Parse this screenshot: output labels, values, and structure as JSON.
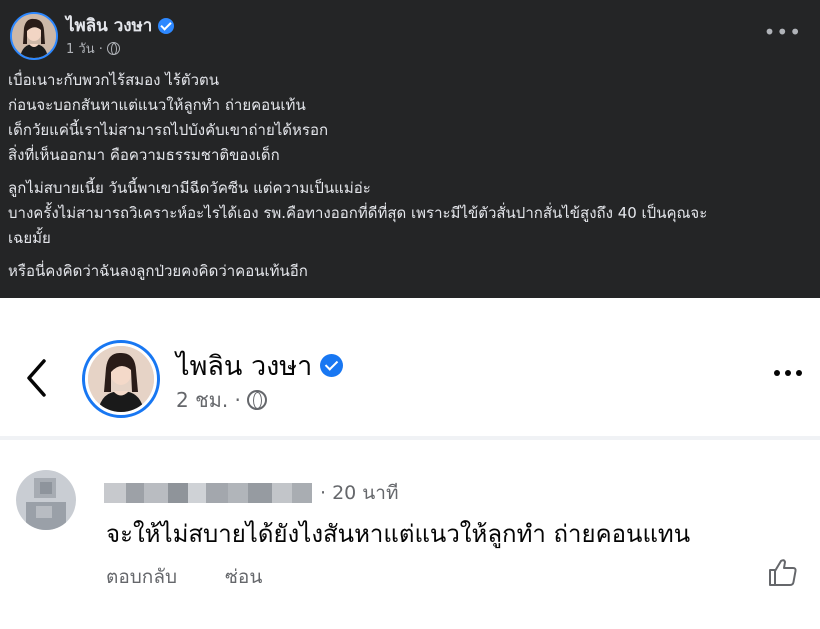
{
  "dark_post": {
    "author": "ไพลิน วงษา",
    "time": "1 วัน ·",
    "more_label": "•••",
    "lines_p1": [
      "เบื่อเนาะกับพวกไร้สมอง ไร้ตัวตน",
      "ก่อนจะบอกสันหาแต่แนวให้ลูกทำ ถ่ายคอนเท้น",
      "เด็กวัยแค่นี้เราไม่สามารถไปบังคับเขาถ่ายได้หรอก",
      "สิ่งที่เห็นออกมา คือความธรรมชาติของเด็ก"
    ],
    "lines_p2": [
      "ลูกไม่สบายเนี้ย วันนี้พาเขามีฉีดวัคซีน แต่ความเป็นแม่อ่ะ",
      "บางครั้งไม่สามารถวิเคราะห์อะไรได้เอง รพ.คือทางออกที่ดีที่สุด เพราะมีไข้ตัวสั่นปากสั่นไข้สูงถึง 40 เป็นคุณจะ",
      "เฉยมั้ย"
    ],
    "line_p3": "หรือนี่คงคิดว่าฉันลงลูกป่วยคงคิดว่าคอนเท้นอีก"
  },
  "post_header": {
    "author": "ไพลิน วงษา",
    "time": "2 ชม. ·"
  },
  "comment": {
    "time": "· 20 นาที",
    "text": "จะให้ไม่สบายได้ยังไงสันหาแต่แนวให้ลูกทำ ถ่ายคอนแทน",
    "reply_label": "ตอบกลับ",
    "hide_label": "ซ่อน"
  },
  "colors": {
    "dark_bg": "#242526",
    "verified_blue": "#1877f2",
    "secondary_text": "#65676b"
  }
}
